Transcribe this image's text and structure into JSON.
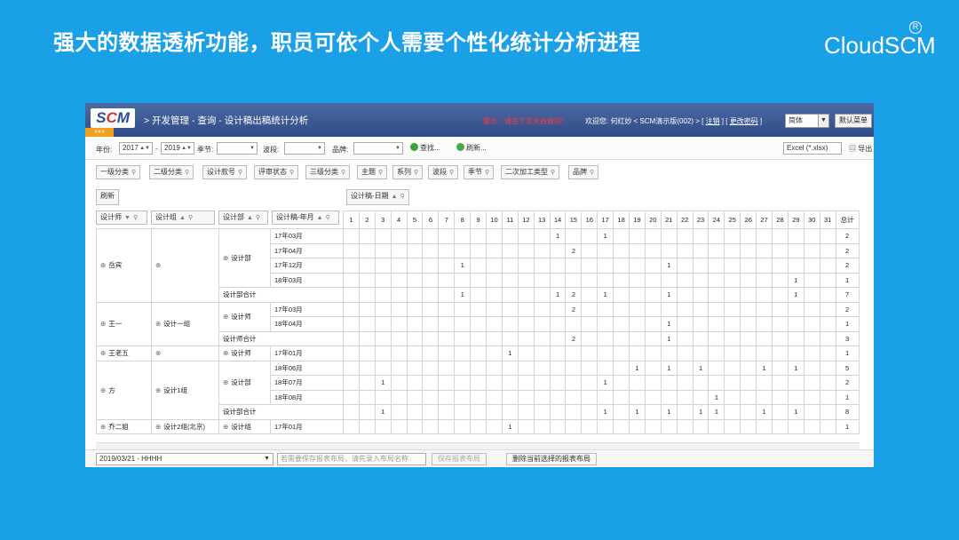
{
  "slide": {
    "title": "强大的数据透析功能，职员可依个人需要个性化统计分析进程",
    "logo": "CloudSCM",
    "reg_mark": "R"
  },
  "header": {
    "logo_left": "S",
    "logo_mid": "C",
    "logo_right": "M",
    "expand": "»»»",
    "breadcrumb": "> 开发管理 - 查询 - 设计稿出稿统计分析",
    "warning": "警示：请在下次未启做到！",
    "welcome_prefix": "欢迎您: 何红妙 < SCM演示版(002) > [ ",
    "logout": "注销",
    "mid": " ] [ ",
    "change_pwd": "更改密码",
    "suffix": " ]",
    "language": "简体",
    "menu_button": "默认菜单"
  },
  "filters": {
    "year_label": "年份:",
    "year_from": "2017",
    "dash": "-",
    "year_to": "2019",
    "season_label": "季节:",
    "wave_label": "波段:",
    "brand_label": "品牌:",
    "search_button": "查找...",
    "refresh_button": "刷新...",
    "export_format": "Excel (*.xlsx)",
    "export_button": "导出"
  },
  "dimensions": [
    "一级分类",
    "二级分类",
    "设计款号",
    "评审状态",
    "三级分类",
    "主题",
    "系列",
    "波段",
    "季节",
    "二次加工类型",
    "品牌"
  ],
  "refresh_label": "刷新",
  "column_field": "设计稿-日期",
  "row_fields": [
    "设计师",
    "设计组",
    "设计部",
    "设计稿-年月"
  ],
  "days": [
    "1",
    "2",
    "3",
    "4",
    "5",
    "6",
    "7",
    "8",
    "9",
    "10",
    "11",
    "12",
    "13",
    "14",
    "15",
    "16",
    "17",
    "18",
    "19",
    "20",
    "21",
    "22",
    "23",
    "24",
    "25",
    "26",
    "27",
    "28",
    "29",
    "30",
    "31"
  ],
  "total_label": "总计",
  "rows": [
    {
      "designer": "岳宾",
      "group": "",
      "dept": "设计部",
      "month": "17年03月",
      "cells": {
        "14": "1",
        "17": "1"
      },
      "total": "2"
    },
    {
      "month": "17年04月",
      "cells": {
        "15": "2"
      },
      "total": "2"
    },
    {
      "month": "17年12月",
      "cells": {
        "8": "1",
        "21": "1"
      },
      "total": "2"
    },
    {
      "month": "18年03月",
      "cells": {
        "29": "1"
      },
      "total": "1"
    },
    {
      "subtotal": "设计部合计",
      "cells": {
        "8": "1",
        "14": "1",
        "15": "2",
        "17": "1",
        "21": "1",
        "29": "1"
      },
      "total": "7"
    },
    {
      "designer": "王一",
      "group": "设计一组",
      "dept": "设计师",
      "month": "17年03月",
      "cells": {
        "15": "2"
      },
      "total": "2"
    },
    {
      "month": "18年04月",
      "cells": {
        "21": "1"
      },
      "total": "1"
    },
    {
      "subtotal": "设计师合计",
      "cells": {
        "15": "2",
        "21": "1"
      },
      "total": "3"
    },
    {
      "designer": "王老五",
      "group": "",
      "dept": "设计师",
      "month": "17年01月",
      "cells": {
        "11": "1"
      },
      "total": "1"
    },
    {
      "designer": "方",
      "group": "设计1组",
      "dept": "设计部",
      "month": "18年06月",
      "cells": {
        "19": "1",
        "21": "1",
        "23": "1",
        "27": "1",
        "29": "1"
      },
      "total": "5"
    },
    {
      "month": "18年07月",
      "cells": {
        "3": "1",
        "17": "1"
      },
      "total": "2"
    },
    {
      "month": "18年08月",
      "cells": {
        "24": "1"
      },
      "total": "1"
    },
    {
      "subtotal": "设计部合计",
      "cells": {
        "3": "1",
        "17": "1",
        "19": "1",
        "21": "1",
        "23": "1",
        "24": "1",
        "27": "1",
        "29": "1"
      },
      "total": "8"
    },
    {
      "designer": "乔二姐",
      "group": "设计2组(北京)",
      "dept": "设计组",
      "month": "17年01月",
      "cells": {
        "11": "1"
      },
      "total": "1"
    }
  ],
  "footer": {
    "layout_value": "2019/03/21 - HHHH",
    "layout_name_placeholder": "若需要保存报表布局，请先录入布局名称",
    "save_button": "保存报表布局",
    "delete_button": "删除当前选择的报表布局"
  }
}
